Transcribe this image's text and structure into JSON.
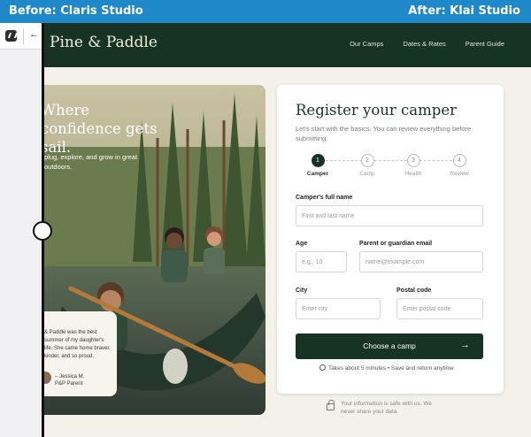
{
  "comparison": {
    "before_label": "Before: Claris Studio",
    "after_label": "After: Klai Studio"
  },
  "before_panel": {
    "back_glyph": "←"
  },
  "site": {
    "brand": "Pine & Paddle",
    "nav": [
      "Our Camps",
      "Dates & Rates",
      "Parent Guide"
    ]
  },
  "hero": {
    "title": "Where confidence gets sail.",
    "text": "plug, explore, and grow in great outdoors.",
    "quote": "& Paddle was the best summer of my daughter's life. She came home braver, kinder, and so proud.",
    "quote_name": "– Jessica M.",
    "quote_role": "P&P Parent"
  },
  "form": {
    "title": "Register your camper",
    "subtitle": "Let's start with the basics. You can review everything before submitting.",
    "steps": [
      {
        "num": "1",
        "label": "Camper"
      },
      {
        "num": "2",
        "label": "Camp"
      },
      {
        "num": "3",
        "label": "Health"
      },
      {
        "num": "4",
        "label": "Review"
      }
    ],
    "full_name_label": "Camper's full name",
    "full_name_placeholder": "First and last name",
    "age_label": "Age",
    "age_placeholder": "e.g., 10",
    "email_label": "Parent or guardian email",
    "email_placeholder": "name@example.com",
    "city_label": "City",
    "city_placeholder": "Enter city",
    "postal_label": "Postal code",
    "postal_placeholder": "Enter postal code",
    "cta_label": "Choose a camp",
    "cta_arrow": "→",
    "footnote": "Takes about 5 minutes  •  Save and return anytime"
  },
  "secure_note": "Your information is safe with us. We never share your data.",
  "colors": {
    "accent": "#1e88c8",
    "forest": "#163324",
    "page": "#f4f1ea"
  }
}
